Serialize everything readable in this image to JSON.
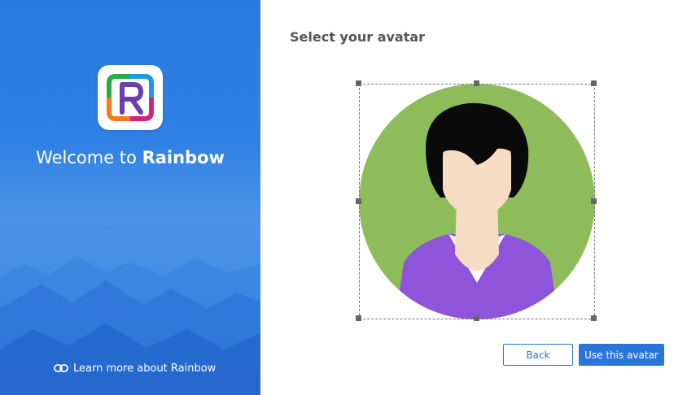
{
  "sidebar": {
    "welcome_prefix": "Welcome to ",
    "brand_name": "Rainbow",
    "learn_more": "Learn more about Rainbow",
    "logo_icon": "rainbow-logo-icon",
    "link_icon": "link-icon"
  },
  "main": {
    "title": "Select your avatar",
    "back_label": "Back",
    "use_label": "Use this avatar"
  },
  "colors": {
    "accent": "#2a75d8",
    "avatar_bg": "#8fbc5a",
    "avatar_shirt": "#8e55db",
    "avatar_skin": "#f6dcc2",
    "avatar_hair": "#0a0a0a"
  }
}
